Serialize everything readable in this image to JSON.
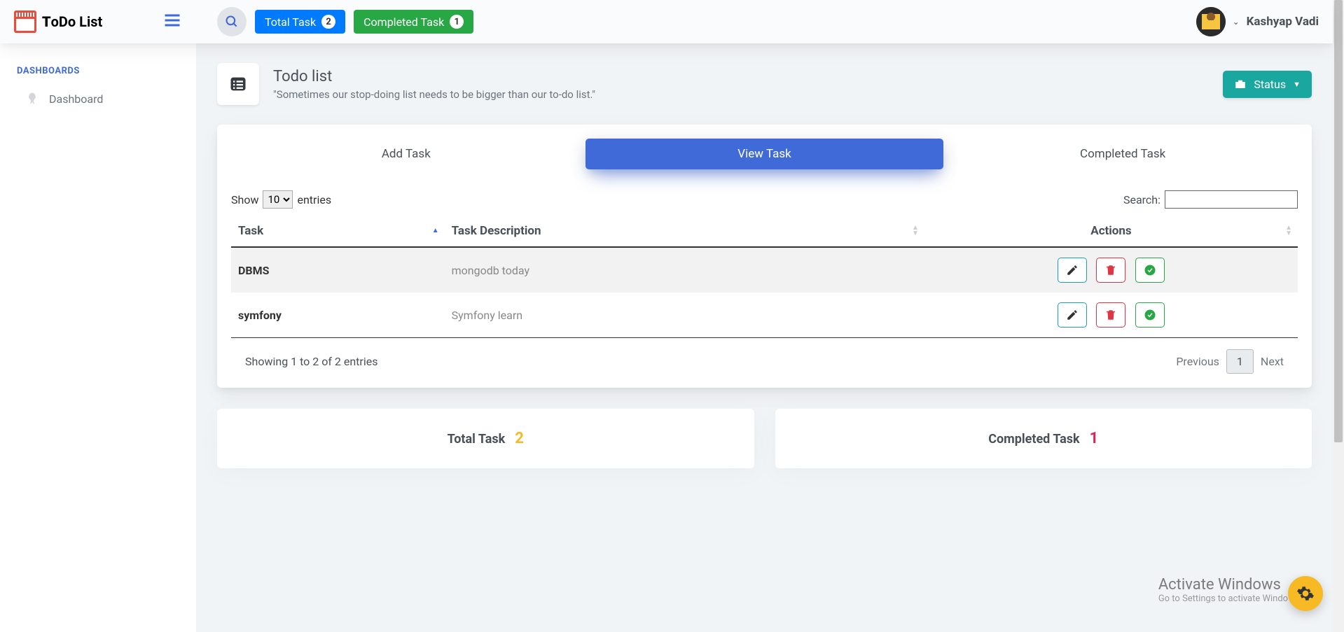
{
  "app": {
    "logo_text_prefix": "T",
    "logo_text_mid": "oDo",
    "logo_text_suffix": " List"
  },
  "topbar": {
    "total_task_label": "Total Task",
    "total_task_count": "2",
    "completed_task_label": "Completed Task",
    "completed_task_count": "1",
    "username": "Kashyap Vadi"
  },
  "sidebar": {
    "section": "DASHBOARDS",
    "items": [
      {
        "label": "Dashboard"
      }
    ]
  },
  "page": {
    "title": "Todo list",
    "subtitle": "\"Sometimes our stop-doing list needs to be bigger than our to-do list.\"",
    "status_label": "Status"
  },
  "tabs": {
    "add": "Add Task",
    "view": "View Task",
    "completed": "Completed Task"
  },
  "table": {
    "show_label": "Show",
    "show_value": "10",
    "entries_label": "entries",
    "search_label": "Search:",
    "headers": {
      "task": "Task",
      "desc": "Task Description",
      "actions": "Actions"
    },
    "rows": [
      {
        "task": "DBMS",
        "desc": "mongodb today"
      },
      {
        "task": "symfony",
        "desc": "Symfony learn"
      }
    ],
    "info": "Showing 1 to 2 of 2 entries",
    "prev": "Previous",
    "page": "1",
    "next": "Next"
  },
  "stats": {
    "total_label": "Total Task",
    "total_value": "2",
    "completed_label": "Completed Task",
    "completed_value": "1"
  },
  "watermark": {
    "line1": "Activate Windows",
    "line2": "Go to Settings to activate Windows."
  }
}
